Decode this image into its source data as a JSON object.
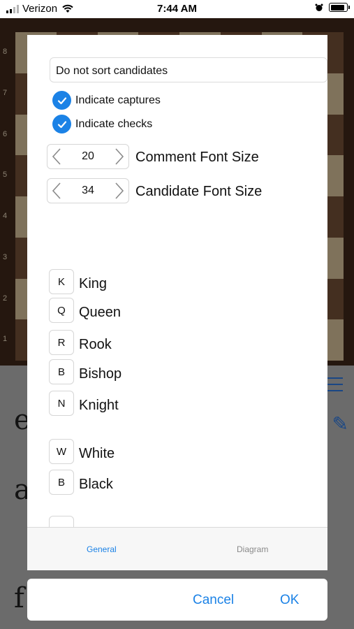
{
  "status_bar": {
    "carrier": "Verizon",
    "time": "7:44 AM"
  },
  "board": {
    "ranks": [
      "8",
      "7",
      "6",
      "5",
      "4",
      "3",
      "2",
      "1"
    ]
  },
  "settings": {
    "sort_selection": "Do not sort candidates",
    "checkboxes": [
      {
        "label": "Indicate captures",
        "checked": true
      },
      {
        "label": "Indicate checks",
        "checked": true
      }
    ],
    "steppers": [
      {
        "value": "20",
        "label": "Comment Font Size"
      },
      {
        "value": "34",
        "label": "Candidate Font Size"
      }
    ],
    "piece_keys": [
      {
        "key": "K",
        "label": "King"
      },
      {
        "key": "Q",
        "label": "Queen"
      },
      {
        "key": "R",
        "label": "Rook"
      },
      {
        "key": "B",
        "label": "Bishop"
      },
      {
        "key": "N",
        "label": "Knight"
      }
    ],
    "color_keys": [
      {
        "key": "W",
        "label": "White"
      },
      {
        "key": "B",
        "label": "Black"
      }
    ]
  },
  "tabs": {
    "general": "General",
    "diagram": "Diagram"
  },
  "actions": {
    "cancel": "Cancel",
    "ok": "OK"
  },
  "colors": {
    "accent": "#1b82e6"
  }
}
